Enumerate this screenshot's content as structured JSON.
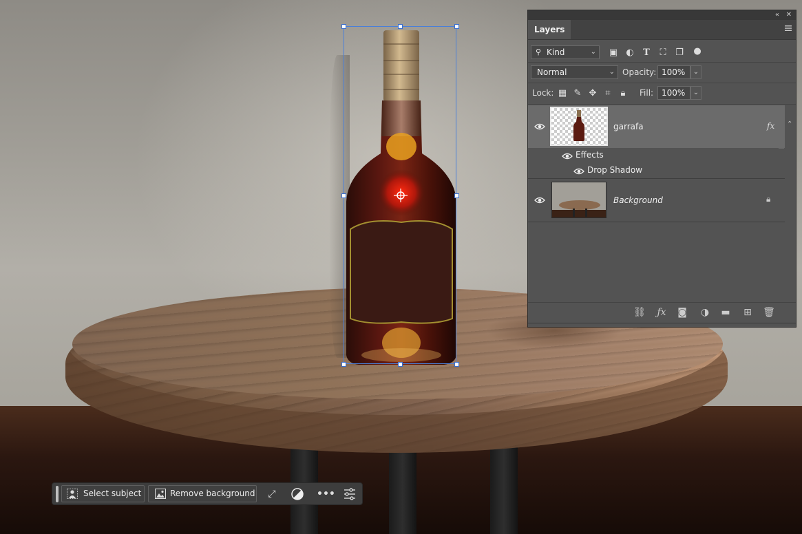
{
  "layers_panel": {
    "tab_label": "Layers",
    "filter": {
      "kind_label": "Kind"
    },
    "blend_mode": "Normal",
    "opacity_label": "Opacity:",
    "opacity_value": "100%",
    "lock_label": "Lock:",
    "fill_label": "Fill:",
    "fill_value": "100%",
    "layers": [
      {
        "name": "garrafa",
        "fx_label": "fx",
        "effects_label": "Effects",
        "effect_items": [
          "Drop Shadow"
        ]
      },
      {
        "name": "Background"
      }
    ]
  },
  "taskbar": {
    "select_subject_label": "Select subject",
    "remove_background_label": "Remove background"
  },
  "colors": {
    "panel_bg": "#535353",
    "selected_row_bg": "#6b6b6b",
    "selection_border": "#4a7fd8"
  }
}
